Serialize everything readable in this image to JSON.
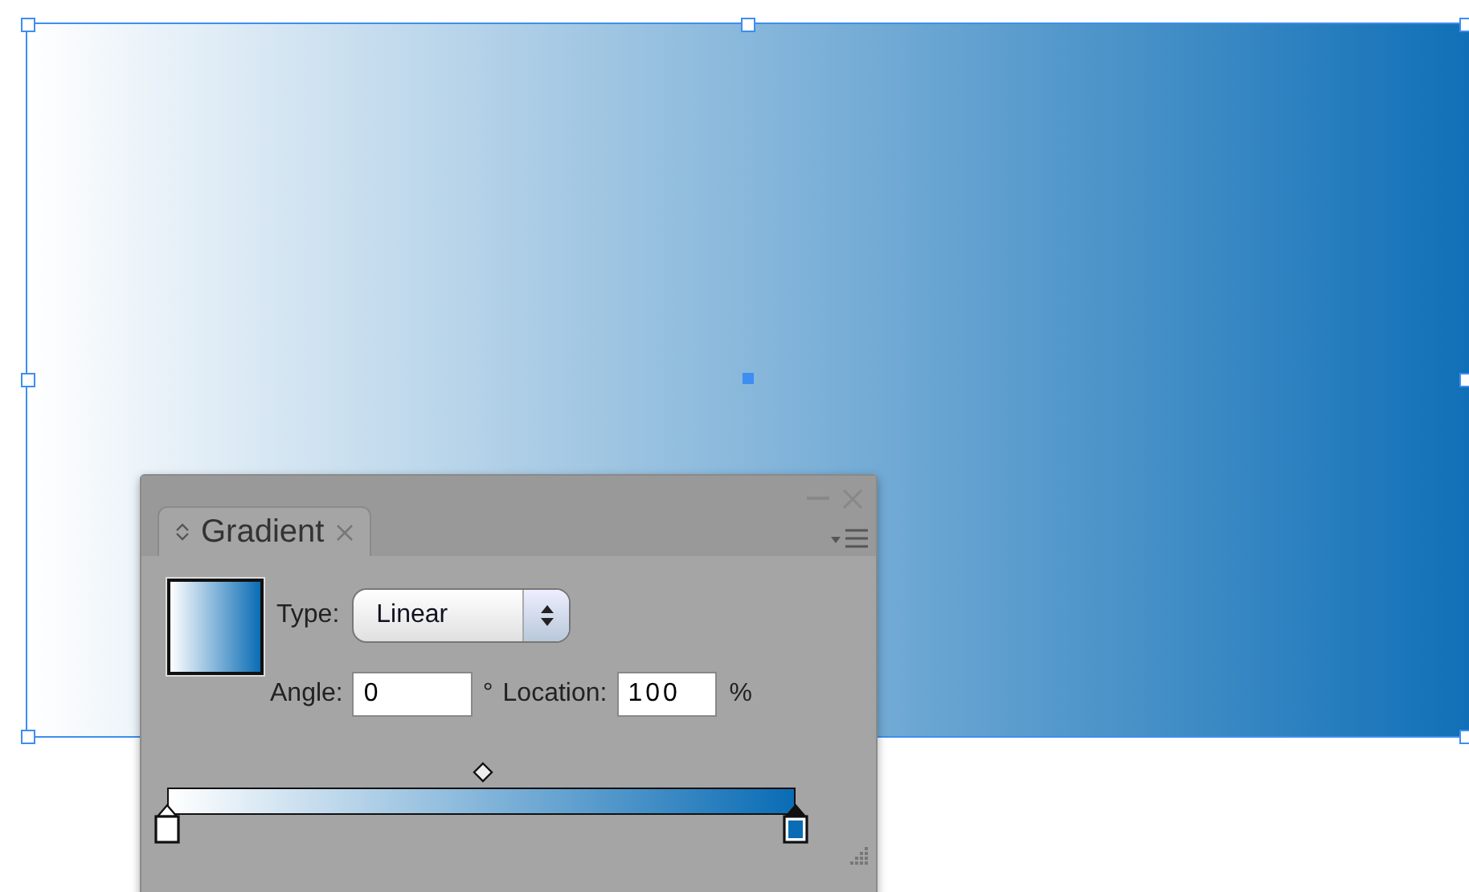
{
  "panel": {
    "tab": {
      "label": "Gradient",
      "selected": true
    },
    "type_label": "Type:",
    "type_value": "Linear",
    "angle_label": "Angle:",
    "angle_value": "0",
    "degree_sign": "°",
    "location_label": "Location:",
    "location_value": "100",
    "percent_sign": "%",
    "midpoint": {
      "level": 0.5
    },
    "stops": [
      {
        "color": "#ffffff",
        "level": 0,
        "selected": false
      },
      {
        "color": "#0a6cb5",
        "level": 1,
        "selected": true
      }
    ]
  }
}
